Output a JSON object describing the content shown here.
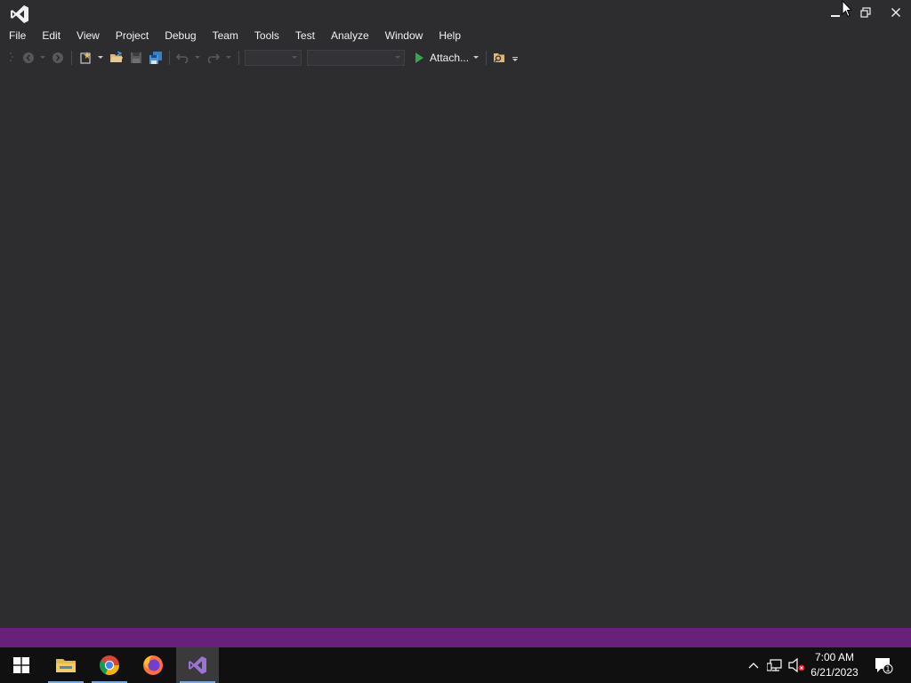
{
  "menubar": {
    "items": [
      "File",
      "Edit",
      "View",
      "Project",
      "Debug",
      "Team",
      "Tools",
      "Test",
      "Analyze",
      "Window",
      "Help"
    ]
  },
  "toolbar": {
    "attach_label": "Attach...",
    "solution_config_value": "",
    "solution_platform_value": ""
  },
  "taskbar": {
    "time": "7:00 AM",
    "date": "6/21/2023",
    "notification_count": "1"
  },
  "colors": {
    "background": "#2d2d30",
    "status_bar": "#68217a",
    "taskbar": "#101010",
    "run_green": "#3ba24f",
    "vs_purple": "#9b73d6"
  }
}
